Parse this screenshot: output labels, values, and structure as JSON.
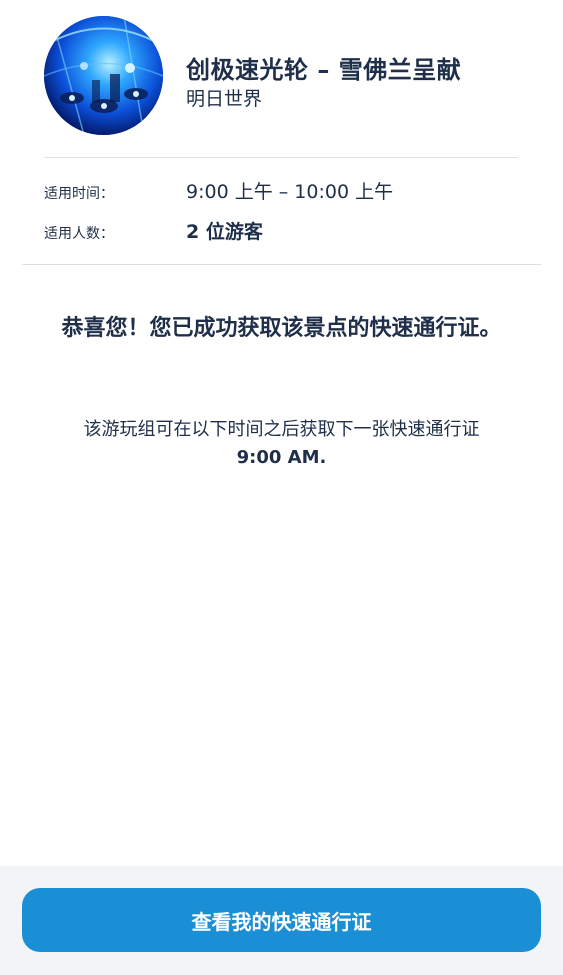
{
  "attraction": {
    "title": "创极速光轮 – 雪佛兰呈献",
    "location": "明日世界",
    "image_icon": "attraction-photo"
  },
  "details": {
    "time_label": "适用时间：",
    "time_value": "9:00 上午 – 10:00 上午",
    "guests_label": "适用人数：",
    "guests_value": "2 位游客"
  },
  "confirmation": {
    "heading": "恭喜您！您已成功获取该景点的快速通行证。",
    "next_text": "该游玩组可在以下时间之后获取下一张快速通行证",
    "next_time": "9:00 AM."
  },
  "footer": {
    "button_label": "查看我的快速通行证"
  },
  "colors": {
    "text": "#1f2f4a",
    "button": "#1a8fd6",
    "footer_bg": "#f3f4f6",
    "divider": "#dcdfe4"
  }
}
